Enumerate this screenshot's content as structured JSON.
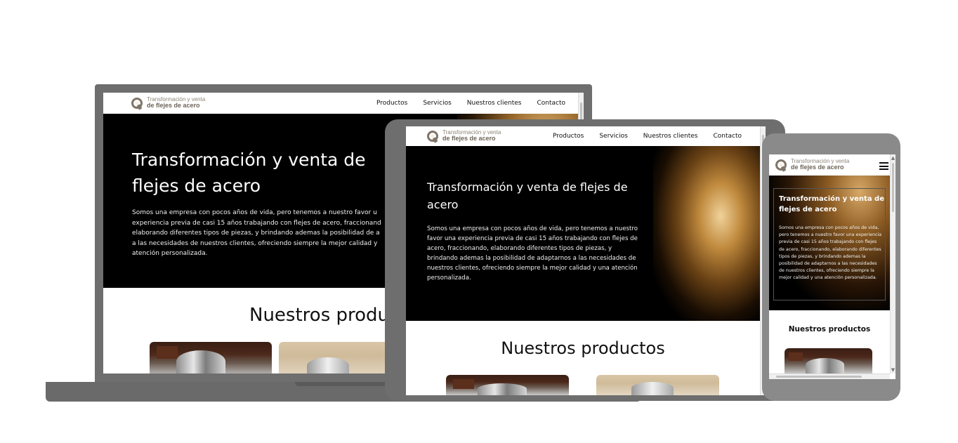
{
  "site": {
    "logo": {
      "line1": "Transformación y venta",
      "line2": "de flejes de acero"
    },
    "nav": [
      "Productos",
      "Servicios",
      "Nuestros clientes",
      "Contacto"
    ],
    "hero": {
      "title": "Transformación y venta de flejes de acero",
      "body": "Somos una empresa con pocos años de vida, pero tenemos a nuestro favor una experiencia previa de casi 15 años trabajando con flejes de acero, fraccionando, elaborando diferentes tipos de piezas, y brindando ademas la posibilidad de adaptarnos a las necesidades de nuestros clientes, ofreciendo siempre la mejor calidad y una atención personalizada."
    },
    "laptop_hero": {
      "title_line1": "Transformación y venta de",
      "title_line2": "flejes de acero",
      "body_lines": [
        "Somos una empresa con pocos años de vida, pero tenemos a nuestro favor u",
        "experiencia previa de casi 15 años trabajando con flejes de acero, fraccionand",
        "elaborando diferentes tipos de piezas, y brindando ademas la posibilidad de a",
        "a las necesidades de nuestros clientes, ofreciendo siempre la mejor calidad y",
        "atención personalizada."
      ]
    },
    "products_title": "Nuestros productos",
    "products_title_laptop": "Nuestros produ"
  },
  "colors": {
    "frame": "#6e6e6e",
    "hero_bg": "#000000",
    "logo_text": "#6e6458"
  },
  "icons": [
    "logo-ring-icon",
    "hamburger-menu-icon",
    "scroll-up-arrow-icon",
    "scroll-down-arrow-icon"
  ]
}
